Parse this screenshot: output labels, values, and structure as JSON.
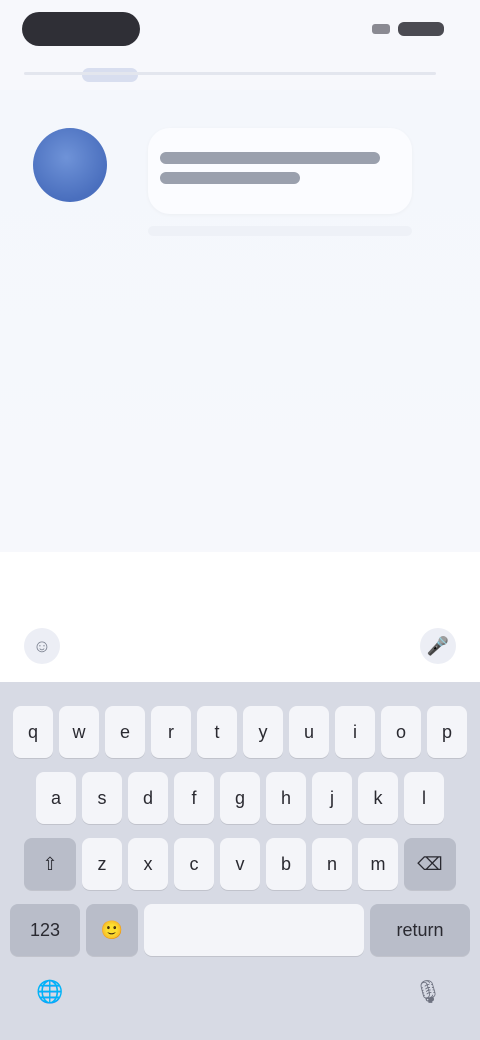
{
  "status": {
    "time": "",
    "icons": [
      "signal-icon",
      "battery-icon"
    ]
  },
  "chat": {
    "messages": [
      {
        "text_lines": [
          "",
          ""
        ]
      }
    ]
  },
  "composer": {
    "hint": "",
    "left_icon": "emoji-icon",
    "right_icon": "mic-icon"
  },
  "keyboard": {
    "row1": [
      "q",
      "w",
      "e",
      "r",
      "t",
      "y",
      "u",
      "i",
      "o",
      "p"
    ],
    "row2": [
      "a",
      "s",
      "d",
      "f",
      "g",
      "h",
      "j",
      "k",
      "l"
    ],
    "row3": [
      "⇧",
      "z",
      "x",
      "c",
      "v",
      "b",
      "n",
      "m",
      "⌫"
    ],
    "row4": [
      "123",
      "🙂",
      "space",
      "return"
    ],
    "bottom_left_icon": "globe-icon",
    "bottom_right_icon": "dictation-icon"
  },
  "colors": {
    "avatar": "#5b80cc",
    "keyboard_bg": "#d7dae4",
    "key_bg": "#f4f5f9",
    "dark_key_bg": "#b9bdc9"
  }
}
